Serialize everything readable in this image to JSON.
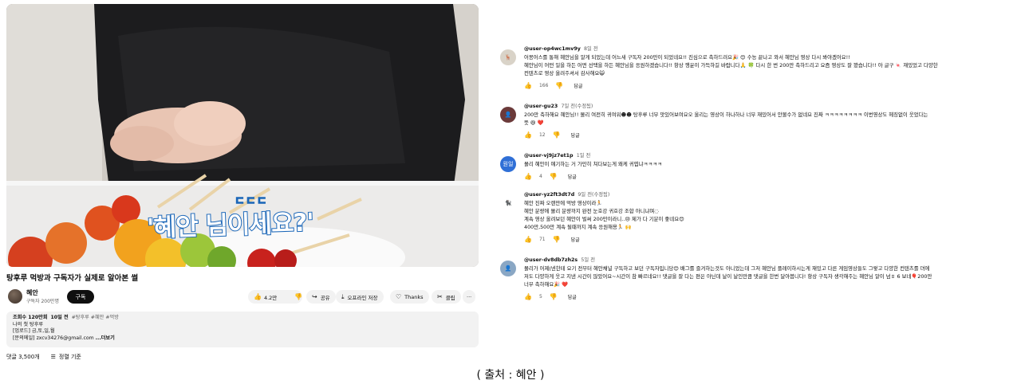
{
  "video": {
    "caption_main": "'혜안 님이세요?'",
    "caption_small": "ㄷㄷㄷ",
    "title": "탕후루 먹방과 구독자가 실제로 알아본 썰"
  },
  "channel": {
    "name": "혜안",
    "subscribers": "구독자 200만명",
    "subscribe_label": "구독"
  },
  "actions": {
    "like_count": "4.2만",
    "share_label": "공유",
    "offline_label": "오프라인 저장",
    "thanks_label": "Thanks",
    "clip_label": "클립",
    "more_label": "···"
  },
  "description": {
    "views": "조회수 120만회",
    "date": "10일 전",
    "tags": "#탕후루 #혜안 #먹방",
    "line1": "나의 첫 탕후루",
    "line2": "[업로드] 금,토,일,월",
    "line3": "[문의메일] zxcv34276@gmail.com",
    "more": "...더보기"
  },
  "comments_header": {
    "count": "댓글 3,500개",
    "sort_label": "정렬 기준"
  },
  "comments": [
    {
      "user": "@user-op4wc1mv9y",
      "time": "8일 전",
      "lines": [
        "어몽어스를 통해 혜안님을 알게 되었는데 어느새 구독자 200만이 되었네요!! 진심으로 축하드려요🎉 😊 수능 끝나고 와서 혜안님 영상 다시 봐야겠어요!!",
        "혜안님이 어떤 일을 하든 어떤 선택을 하든 혜안님을 응원하겠습니다!! 항상 행운이 가득하길 바랍니다🙏 🍀 다시 한 번 200만 축하드리고 요즘 영상도 잘 봤습니다!! 아 글구 🍬 재밌었고 다양한",
        "컨텐츠로 영상 올려주셔서 감사해요😺"
      ],
      "likes": "166",
      "reply": "답글",
      "avatar_color": "#d9d3c8",
      "avatar_text": "🦌"
    },
    {
      "user": "@user-gu23",
      "time": "7일 전(수정됨)",
      "lines": [
        "200만 축하해요 혜안님!! 몰리 여전히 귀여워☻☻ 탕후루 너무 맛있어보여요오 올리는 영상이 하나하나 너무 재밌어서 안볼수가 없네요 진짜 ㅋㅋㅋㅋㅋㅋㅋㅋ 이번영상도 헤징없이 웃었다는",
        "뜻 😆 ❤️"
      ],
      "likes": "12",
      "reply": "답글",
      "avatar_color": "#6b3a3a",
      "avatar_text": "👤"
    },
    {
      "user": "@user-vj9jz7et1p",
      "time": "1일 전",
      "lines": [
        "몰리 혜안이 얘기하는 거 가만히 쳐다보는게 왜케 귀엽냐ㅋㅋㅋㅋ"
      ],
      "likes": "4",
      "reply": "답글",
      "avatar_color": "#2f6fd6",
      "avatar_text": "원일"
    },
    {
      "user": "@user-yz2ft3dt7d",
      "time": "9일 전(수정됨)",
      "lines": [
        "혜안 진짜 오랜만에 먹방 영상이라🏃",
        "혜안 분량에 몰리 분량까지 완전 눈호강 귀호강 조합 아니냐며◌",
        "계속 영상 올려보던 혜안이 벌써 200만이라니..😢 제가 다 기분이 좋네요😊",
        "400만,500만 계속 될때까지 계속 응원해용🏃 🙌"
      ],
      "likes": "71",
      "reply": "답글",
      "avatar_color": "#ffffff",
      "avatar_text": "🐈‍⬛"
    },
    {
      "user": "@user-dv8db7zh2s",
      "time": "5일 전",
      "lines": [
        "몰리가 어제(넨한테 요기 전부터 혜안채널 구독하고 보던 구독자입니당😊 배그를 즐겨하는것도 아니었는데 그저 혜안님 플레이하시는게 재밌고 다른 게임영상들도 그렇고 다양한 컨텐츠를 뎌에",
        "저도 다양하게 웃고 지낸 시간이 많았어요~시간이 참 빠르네요!! 댓글을 잘 다는 편은 아닌데 날이 날인만큼 댓글을 한번 달아봅니다! 항상 구독자 생각해주는 혜안님 알이 넘ㅎ 6 보네🎈200만",
        "너무 축하해요🎉 ❤️"
      ],
      "likes": "5",
      "reply": "답글",
      "avatar_color": "#8aa7c4",
      "avatar_text": "👤"
    }
  ],
  "credit": "( 출처 : 혜안 )"
}
